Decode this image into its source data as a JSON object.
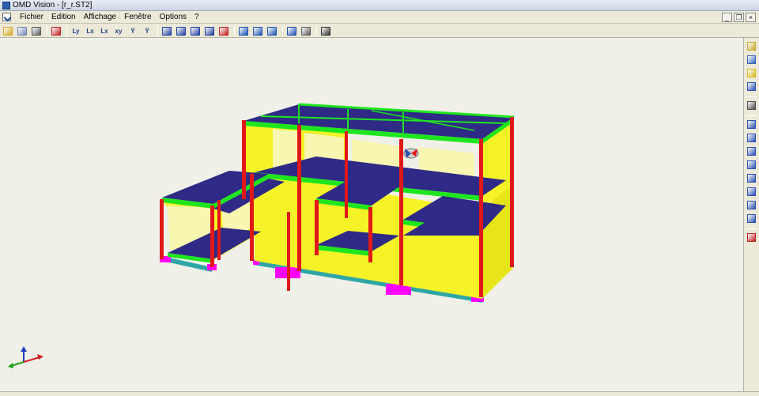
{
  "window": {
    "title": "OMD Vision - [r_r.ST2]"
  },
  "menu": {
    "items": [
      {
        "name": "menu-fichier",
        "label": "Fichier"
      },
      {
        "name": "menu-edition",
        "label": "Edition"
      },
      {
        "name": "menu-affichage",
        "label": "Affichage"
      },
      {
        "name": "menu-fenetre",
        "label": "Fenêtre"
      },
      {
        "name": "menu-options",
        "label": "Options"
      },
      {
        "name": "menu-help",
        "label": "?"
      }
    ],
    "mdi_minimize": "_",
    "mdi_restore": "❐",
    "mdi_close": "×"
  },
  "toolbar": {
    "groups": [
      [
        {
          "name": "open-folder-icon",
          "color": "#d8a820"
        },
        {
          "name": "copy-icon",
          "color": "#6f86b8"
        },
        {
          "name": "print-icon",
          "color": "#5a5a5a"
        }
      ],
      [
        {
          "name": "axes-select-icon",
          "color": "#c02020"
        }
      ],
      [
        {
          "name": "view-y-icon",
          "label": "Ly"
        },
        {
          "name": "view-x-icon",
          "label": "Lx"
        },
        {
          "name": "view-minus-x-icon",
          "label": "Lx"
        },
        {
          "name": "view-xy-icon",
          "label": "xy"
        },
        {
          "name": "view-iso-icon",
          "label": "Ÿ"
        },
        {
          "name": "view-iso2-icon",
          "label": "Ÿ"
        }
      ],
      [
        {
          "name": "zoom-window-icon",
          "color": "#2040a0"
        },
        {
          "name": "zoom-in-icon",
          "color": "#2040a0"
        },
        {
          "name": "zoom-out-icon",
          "color": "#2040a0"
        },
        {
          "name": "zoom-all-icon",
          "color": "#2040a0"
        },
        {
          "name": "zoom-dynamic-icon",
          "color": "#c02020"
        }
      ],
      [
        {
          "name": "rotate-icon",
          "color": "#1a50b0"
        },
        {
          "name": "eye-icon",
          "color": "#1a50b0"
        },
        {
          "name": "pan-icon",
          "color": "#1a50b0"
        }
      ],
      [
        {
          "name": "render-icon",
          "color": "#1a50b0"
        },
        {
          "name": "printer-setup-icon",
          "color": "#5a5a5a"
        }
      ],
      [
        {
          "name": "help-binoculars-icon",
          "color": "#303030"
        }
      ]
    ]
  },
  "right_toolbar": {
    "items": [
      {
        "name": "properties-icon",
        "color": "#c8a830"
      },
      {
        "name": "layers-icon",
        "color": "#3a66b8"
      },
      {
        "name": "colors-icon",
        "color": "#d8b820"
      },
      {
        "name": "columns-icon",
        "color": "#2a50b0"
      },
      {
        "name": "sep"
      },
      {
        "name": "mesh-icon",
        "color": "#4a4a4a"
      },
      {
        "name": "sep"
      },
      {
        "name": "beam-icon",
        "color": "#2a50b0"
      },
      {
        "name": "slab-icon",
        "color": "#2a50b0"
      },
      {
        "name": "wall-icon",
        "color": "#2a50b0"
      },
      {
        "name": "column-icon",
        "color": "#2a50b0"
      },
      {
        "name": "foundation-icon",
        "color": "#2a50b0"
      },
      {
        "name": "load-icon",
        "color": "#2a50b0"
      },
      {
        "name": "support-icon",
        "color": "#2a50b0"
      },
      {
        "name": "grid-icon",
        "color": "#2a50b0"
      },
      {
        "name": "sep"
      },
      {
        "name": "delete-icon",
        "color": "#c02020"
      }
    ]
  },
  "colors": {
    "slab": "#2e2a86",
    "wall": "#f5f227",
    "beam": "#1ee61e",
    "column": "#e01818",
    "footing": "#ff00ff",
    "base": "#2fa6a6",
    "viewport_bg": "#f0f0e9"
  }
}
